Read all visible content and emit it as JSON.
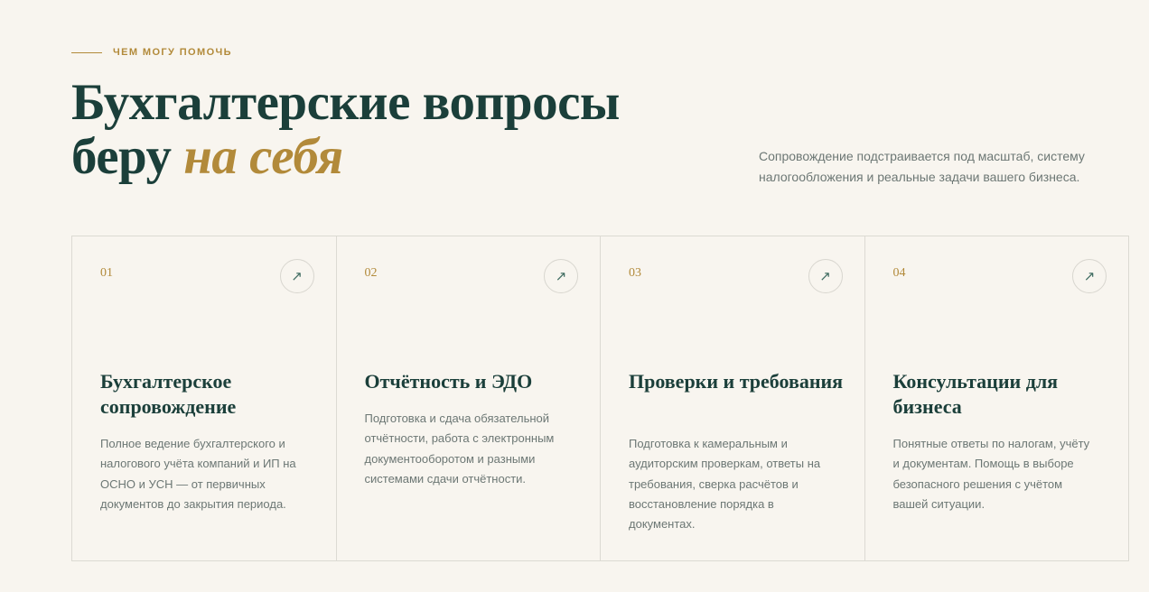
{
  "section": {
    "eyebrow": "ЧЕМ МОГУ ПОМОЧЬ",
    "headline_line1": "Бухгалтерские вопросы",
    "headline_line2_start": "беру ",
    "headline_line2_accent": "на себя",
    "lead": "Сопровождение подстраивается под масштаб, систему налогообложения и реальные задачи вашего бизнеса."
  },
  "colors": {
    "accent": "#b28a3a",
    "primary": "#1b3f3a",
    "muted": "#6c7774",
    "background": "#f8f5ef"
  },
  "cards": [
    {
      "num": "01",
      "icon": "arrow-up-right-icon",
      "arrow": "↗",
      "title": "Бухгалтерское сопровождение",
      "desc": "Полное ведение бухгалтерского и налогового учёта компаний и ИП на ОСНО и УСН — от первичных документов до закрытия периода."
    },
    {
      "num": "02",
      "icon": "arrow-up-right-icon",
      "arrow": "↗",
      "title": "Отчётность и ЭДО",
      "desc": "Подготовка и сдача обязательной отчётности, работа с электронным документооборотом и разными системами сдачи отчётности."
    },
    {
      "num": "03",
      "icon": "arrow-up-right-icon",
      "arrow": "↗",
      "title": "Проверки и требования",
      "desc": "Подготовка к камеральным и аудиторским проверкам, ответы на требования, сверка расчётов и восстановление порядка в документах."
    },
    {
      "num": "04",
      "icon": "arrow-up-right-icon",
      "arrow": "↗",
      "title": "Консультации для бизнеса",
      "desc": "Понятные ответы по налогам, учёту и документам. Помощь в выборе безопасного решения с учётом вашей ситуации."
    }
  ]
}
